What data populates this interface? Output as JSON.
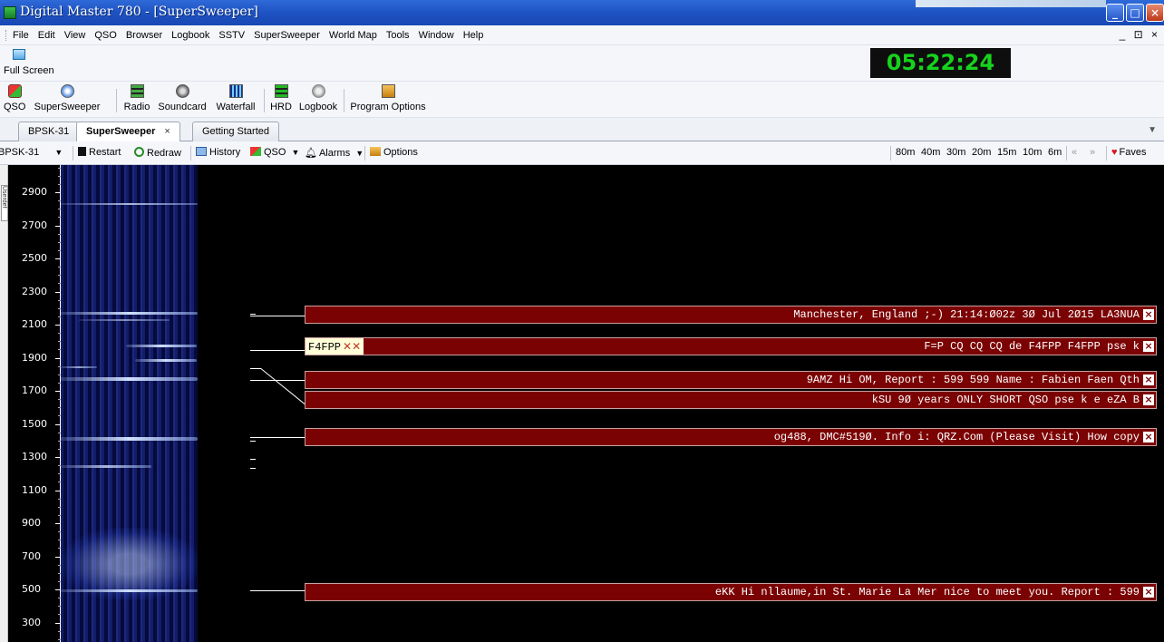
{
  "window": {
    "title": "Digital Master 780 - [SuperSweeper]",
    "buttons": {
      "minimize": "_",
      "restore": "□",
      "close": "×"
    }
  },
  "menu": {
    "items": [
      "File",
      "Edit",
      "View",
      "QSO",
      "Browser",
      "Logbook",
      "SSTV",
      "SuperSweeper",
      "World Map",
      "Tools",
      "Window",
      "Help"
    ],
    "mdi_controls": "_ ⊡ ×"
  },
  "fullscreen_toolbar": {
    "full_screen_label": "Full Screen"
  },
  "clock": {
    "time": "05:22:24",
    "color": "#17d31d"
  },
  "toolbar": {
    "items": [
      {
        "label": "QSO",
        "icon": "qso-icon"
      },
      {
        "label": "SuperSweeper",
        "icon": "supersweeper-icon"
      },
      {
        "label": "Radio",
        "icon": "radio-icon"
      },
      {
        "label": "Soundcard",
        "icon": "soundcard-icon"
      },
      {
        "label": "Waterfall",
        "icon": "waterfall-icon"
      },
      {
        "label": "HRD",
        "icon": "hrd-icon"
      },
      {
        "label": "Logbook",
        "icon": "logbook-icon"
      },
      {
        "label": "Program Options",
        "icon": "program-options-icon"
      }
    ]
  },
  "tabs": [
    {
      "label": "BPSK-31",
      "active": false
    },
    {
      "label": "SuperSweeper",
      "active": true,
      "close": "×"
    },
    {
      "label": "Getting Started",
      "active": false
    }
  ],
  "subtoolbar": {
    "mode_select": "BPSK-31",
    "restart": "Restart",
    "redraw": "Redraw",
    "history": "History",
    "qso": "QSO",
    "alarms": "Alarms",
    "options": "Options",
    "bands": [
      "80m",
      "40m",
      "30m",
      "20m",
      "15m",
      "10m",
      "6m"
    ],
    "prev": "«",
    "next": "»",
    "faves": "Faves"
  },
  "side_panel": {
    "label": "Userdef"
  },
  "frequency_scale": {
    "labels": [
      "2900",
      "2700",
      "2500",
      "2300",
      "2100",
      "1900",
      "1700",
      "1500",
      "1300",
      "1100",
      "900",
      "700",
      "500",
      "300"
    ]
  },
  "messages": [
    {
      "freq": 2140,
      "text": "Manchester, England ;-) 21:14:Ø02z 3Ø Jul 2Ø15 LA3NUA"
    },
    {
      "freq": 1940,
      "callsign": "F4FPP",
      "text": "F=P CQ CQ CQ de F4FPP F4FPP pse k"
    },
    {
      "freq": 1760,
      "text": "9AMZ Hi OM, Report : 599 599 Name : Fabien Faen Qth"
    },
    {
      "freq": 1695,
      "text": "kSU 9Ø years ONLY SHORT QSO pse k e eZA B"
    },
    {
      "freq": 1425,
      "text": "og488, DMC#519Ø. Info i: QRZ.Com (Please Visit) How copy"
    },
    {
      "freq": 505,
      "text": "eKK Hi nllaume,in St. Marie La Mer nice to meet you. Report : 599"
    }
  ],
  "colors": {
    "message_bg": "#7b0203",
    "titlebar": "#1f54c4",
    "display_bg": "#000000"
  }
}
